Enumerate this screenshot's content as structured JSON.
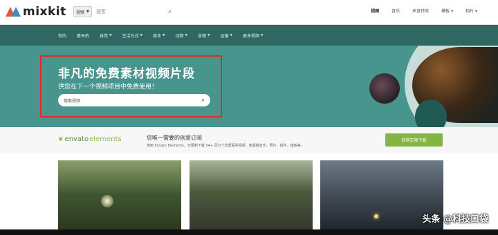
{
  "header": {
    "logo_text": "mixkit",
    "search_category": "视频",
    "search_placeholder": "搜索",
    "nav": [
      "视频",
      "音乐",
      "声音特效",
      "模板 ▾",
      "相片 ▾"
    ]
  },
  "categories": [
    "你的",
    "春天的",
    "自然",
    "生活方式",
    "商业",
    "动物",
    "食物",
    "运输",
    "更多视频"
  ],
  "hero": {
    "title": "非凡的免费素材视频片段",
    "subtitle": "供您在下一个视频项目中免费使用！",
    "search_placeholder": "搜索视频"
  },
  "envato": {
    "logo_prefix": "envato",
    "logo_suffix": "elements",
    "title": "您唯一需要的创意订阅",
    "description": "使用 Envato Elements，无限制下载 54+ 百万个优质股票视频、免版税音乐、照片、插件、模板等。",
    "button_label": "获得无限下载"
  },
  "watermark": "头条 @科技口袋",
  "colors": {
    "catbar": "#2f6863",
    "hero": "#47958d",
    "envato_button": "#82b541",
    "highlight_box": "#e22a2a"
  }
}
